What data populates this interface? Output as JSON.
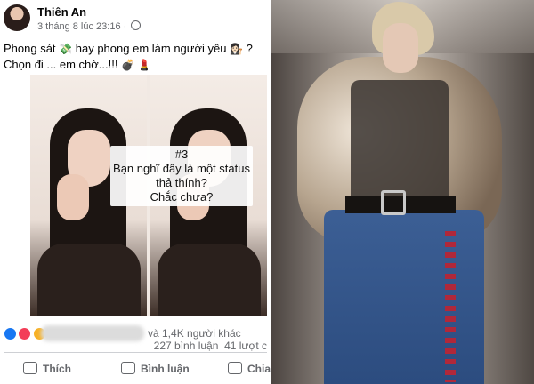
{
  "post": {
    "author": "Thiên An",
    "timestamp": "3 tháng 8 lúc 23:16",
    "separator": "·",
    "caption_line1": "Phong sát",
    "caption_line1b": "hay phong em làm người yêu",
    "caption_line1c": "?",
    "caption_line2": "Chọn đi ... em chờ...!!!",
    "overlay_line1": "#3",
    "overlay_line2": "Bạn nghĩ đây là một status",
    "overlay_line3": "thả thính?",
    "overlay_line4": "Chắc chưa?",
    "reactions_others": "và 1,4K người khác",
    "comments": "227 bình luận",
    "shares": "41 lượt c",
    "actions": {
      "like": "Thích",
      "comment": "Bình luận",
      "share": "Chia"
    }
  },
  "colors": {
    "facebook_blue": "#1877f2",
    "meta_gray": "#65676b",
    "love_red": "#f33e58"
  },
  "icons": [
    "globe-icon",
    "like-icon",
    "comment-icon",
    "share-icon"
  ]
}
